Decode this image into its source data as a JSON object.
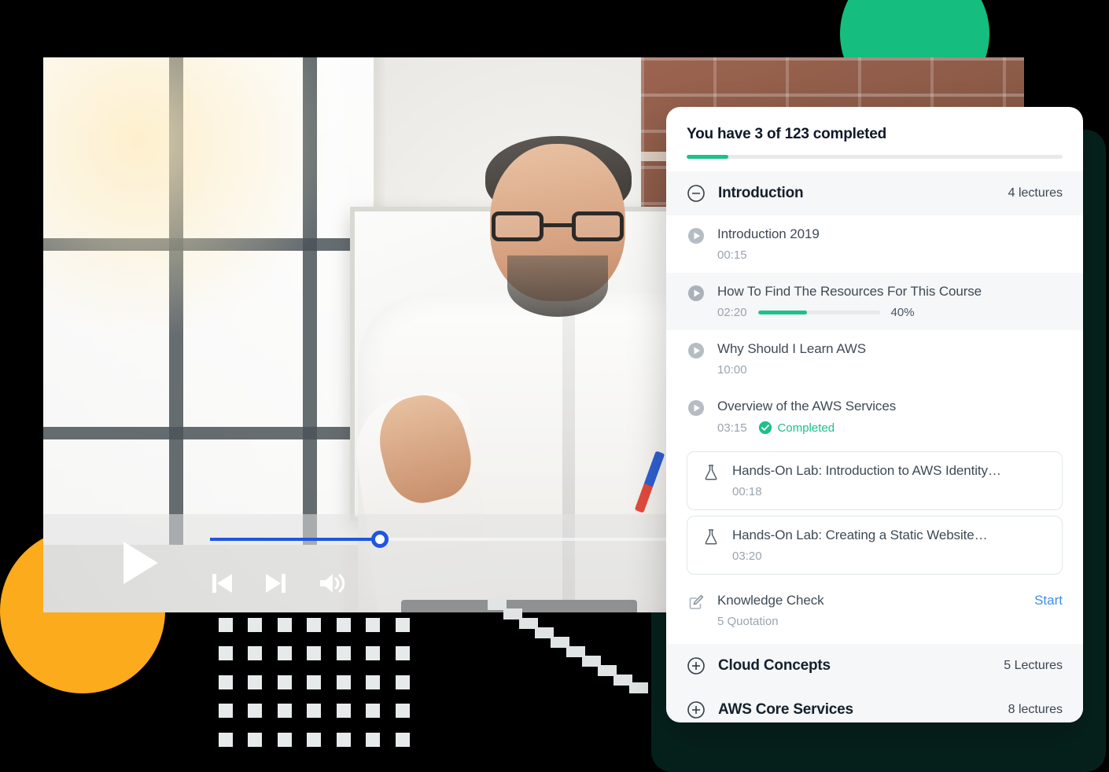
{
  "player": {
    "play_label": "play-button",
    "prev_label": "previous-button",
    "next_label": "next-button",
    "volume_label": "volume-button",
    "progress_percent": 21
  },
  "panel": {
    "heading": "You have 3 of 123 completed",
    "progress_percent": 11,
    "sections": [
      {
        "title": "Introduction",
        "count_label": "4 lectures",
        "state": "expanded",
        "icon": "minus-circle-icon"
      },
      {
        "title": "Cloud Concepts",
        "count_label": "5 Lectures",
        "state": "collapsed",
        "icon": "plus-circle-icon"
      },
      {
        "title": "AWS Core Services",
        "count_label": "8 lectures",
        "state": "collapsed",
        "icon": "plus-circle-icon"
      }
    ],
    "lectures": [
      {
        "title": "Introduction 2019",
        "time": "00:15",
        "icon": "play-circle-icon",
        "active": false,
        "status": "none"
      },
      {
        "title": "How To Find The Resources For This Course",
        "time": "02:20",
        "icon": "play-circle-icon",
        "active": true,
        "status": "progress",
        "progress_percent": 40,
        "progress_label": "40%"
      },
      {
        "title": "Why Should I Learn AWS",
        "time": "10:00",
        "icon": "play-circle-icon",
        "active": false,
        "status": "none"
      },
      {
        "title": "Overview of the AWS Services",
        "time": "03:15",
        "icon": "play-circle-icon",
        "active": false,
        "status": "completed",
        "status_label": "Completed"
      }
    ],
    "labs": [
      {
        "title": "Hands-On Lab: Introduction to AWS Identity…",
        "time": "00:18",
        "icon": "flask-icon"
      },
      {
        "title": "Hands-On Lab: Creating a Static Website…",
        "time": "03:20",
        "icon": "flask-icon"
      }
    ],
    "knowledge_check": {
      "title": "Knowledge Check",
      "subtitle": "5 Quotation",
      "action_label": "Start",
      "icon": "pencil-square-icon"
    }
  },
  "colors": {
    "green": "#1ec08a",
    "green_circle": "#15bd7f",
    "orange": "#fbab1b",
    "blue_link": "#3d8ef0",
    "scrub_blue": "#1f56e0",
    "dark_panel": "#06211c"
  }
}
